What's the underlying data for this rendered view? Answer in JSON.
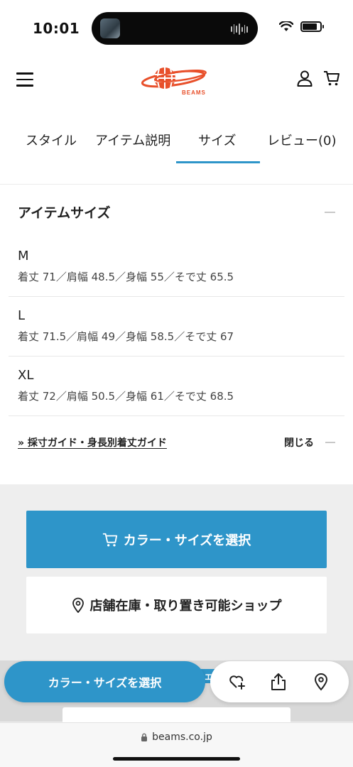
{
  "status_bar": {
    "time": "10:01",
    "battery_level": 0.85,
    "icons": [
      "wifi-icon",
      "battery-icon"
    ]
  },
  "header": {
    "logo_text": "BEAMS",
    "icons": [
      "menu-icon",
      "user-icon",
      "cart-icon"
    ],
    "brand_color": "#e8502b"
  },
  "tabs": [
    {
      "label": "スタイル",
      "active": false
    },
    {
      "label": "アイテム説明",
      "active": false
    },
    {
      "label": "サイズ",
      "active": true
    },
    {
      "label": "レビュー(0)",
      "active": false
    }
  ],
  "size_section": {
    "title": "アイテムサイズ",
    "sizes": [
      {
        "name": "M",
        "detail": "着丈 71／肩幅 48.5／身幅 55／そで丈 65.5"
      },
      {
        "name": "L",
        "detail": "着丈 71.5／肩幅 49／身幅 58.5／そで丈 67"
      },
      {
        "name": "XL",
        "detail": "着丈 72／肩幅 50.5／身幅 61／そで丈 68.5"
      }
    ],
    "guide_link": "» 採寸ガイド・身長別着丈ガイド",
    "close_label": "閉じる"
  },
  "actions": {
    "primary_label": "カラー・サイズを選択",
    "secondary_label": "店舗在庫・取り置き可能ショップ",
    "accent_color": "#2e95c9"
  },
  "floating_bar": {
    "select_label": "カラー・サイズを選択",
    "peek_text": "エ",
    "icons": [
      "heart-plus-icon",
      "share-icon",
      "location-pin-icon"
    ]
  },
  "browser": {
    "url": "beams.co.jp"
  }
}
